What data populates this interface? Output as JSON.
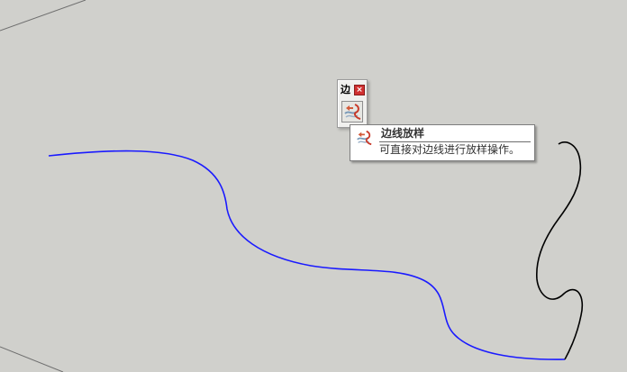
{
  "toolbar": {
    "title": "边",
    "close_label": "×",
    "tool_icon": "edge-stakeout-icon"
  },
  "tooltip": {
    "title": "边线放样",
    "description": "可直接对边线进行放样操作。",
    "icon": "edge-stakeout-icon"
  },
  "colors": {
    "background": "#d0d0cc",
    "path_curve": "#1a1aff",
    "profile_curve": "#000000",
    "axis_line": "#6f6f6f",
    "close_button": "#d03030"
  }
}
